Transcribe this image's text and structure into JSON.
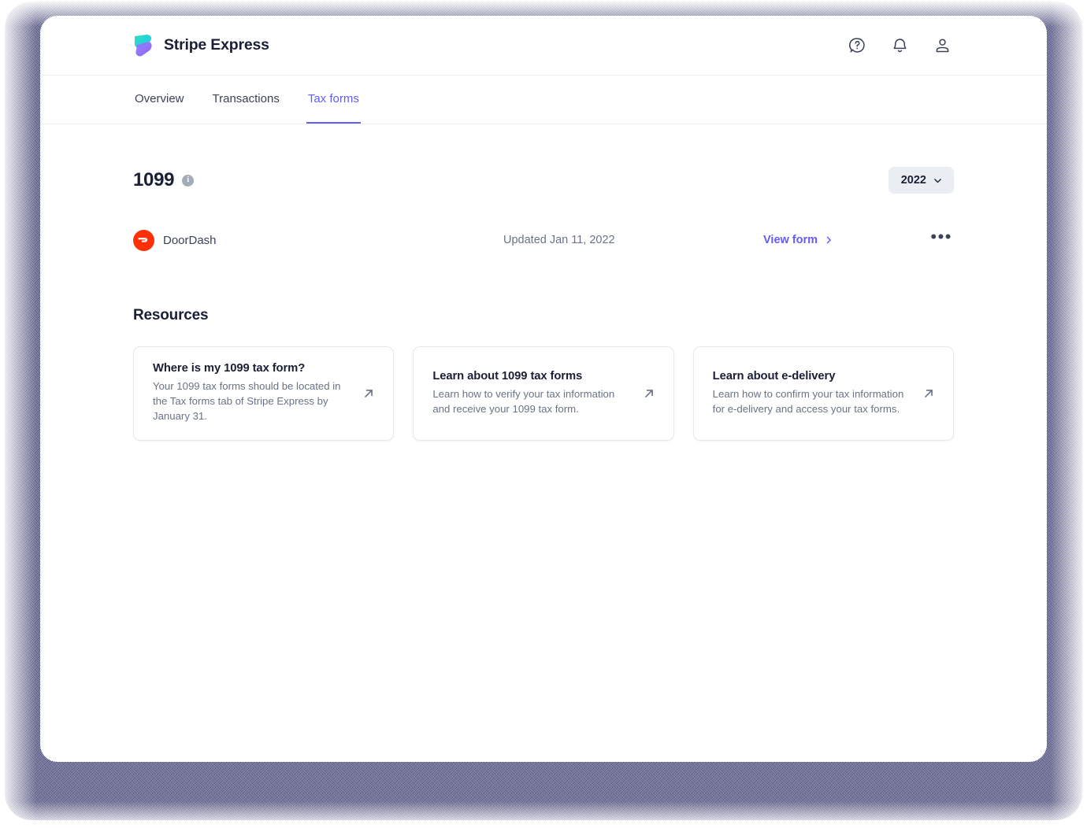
{
  "theme": {
    "brand_purple": "#635bff",
    "frame_navy": "#3c3c6e",
    "text_dark": "#1a1f36",
    "text_muted": "#697386",
    "doordash_red": "#ff3008",
    "card_border": "#e6e9ee"
  },
  "topbar": {
    "logo_icon": "stripe-express-logo-icon",
    "brand_name": "Stripe Express",
    "actions": [
      {
        "icon": "help-circle-icon",
        "name": "help-button"
      },
      {
        "icon": "bell-icon",
        "name": "notifications-button"
      },
      {
        "icon": "user-icon",
        "name": "account-button"
      }
    ]
  },
  "tabs": [
    {
      "label": "Overview",
      "active": false
    },
    {
      "label": "Transactions",
      "active": false
    },
    {
      "label": "Tax forms",
      "active": true
    }
  ],
  "section": {
    "title": "1099",
    "info_icon": "info-icon",
    "info_glyph": "i",
    "year_selector": {
      "value": "2022",
      "chevron_icon": "chevron-down-icon"
    }
  },
  "form_rows": [
    {
      "payer": "DoorDash",
      "payer_logo_icon": "doordash-logo-icon",
      "updated": "Updated Jan 11, 2022",
      "action_label": "View form",
      "action_chevron_icon": "chevron-right-icon",
      "more_label": "•••",
      "more_icon": "ellipsis-icon"
    }
  ],
  "resources": {
    "heading": "Resources",
    "cards": [
      {
        "title": "Where is my 1099 tax form?",
        "description": "Your 1099 tax forms should be located in the Tax forms tab of Stripe Express by January 31.",
        "arrow_icon": "external-link-arrow-icon"
      },
      {
        "title": "Learn about 1099 tax forms",
        "description": "Learn how to verify your tax information and receive your 1099 tax form.",
        "arrow_icon": "external-link-arrow-icon"
      },
      {
        "title": "Learn about e-delivery",
        "description": "Learn how to confirm your tax information for e-delivery and access your tax forms.",
        "arrow_icon": "external-link-arrow-icon"
      }
    ]
  }
}
